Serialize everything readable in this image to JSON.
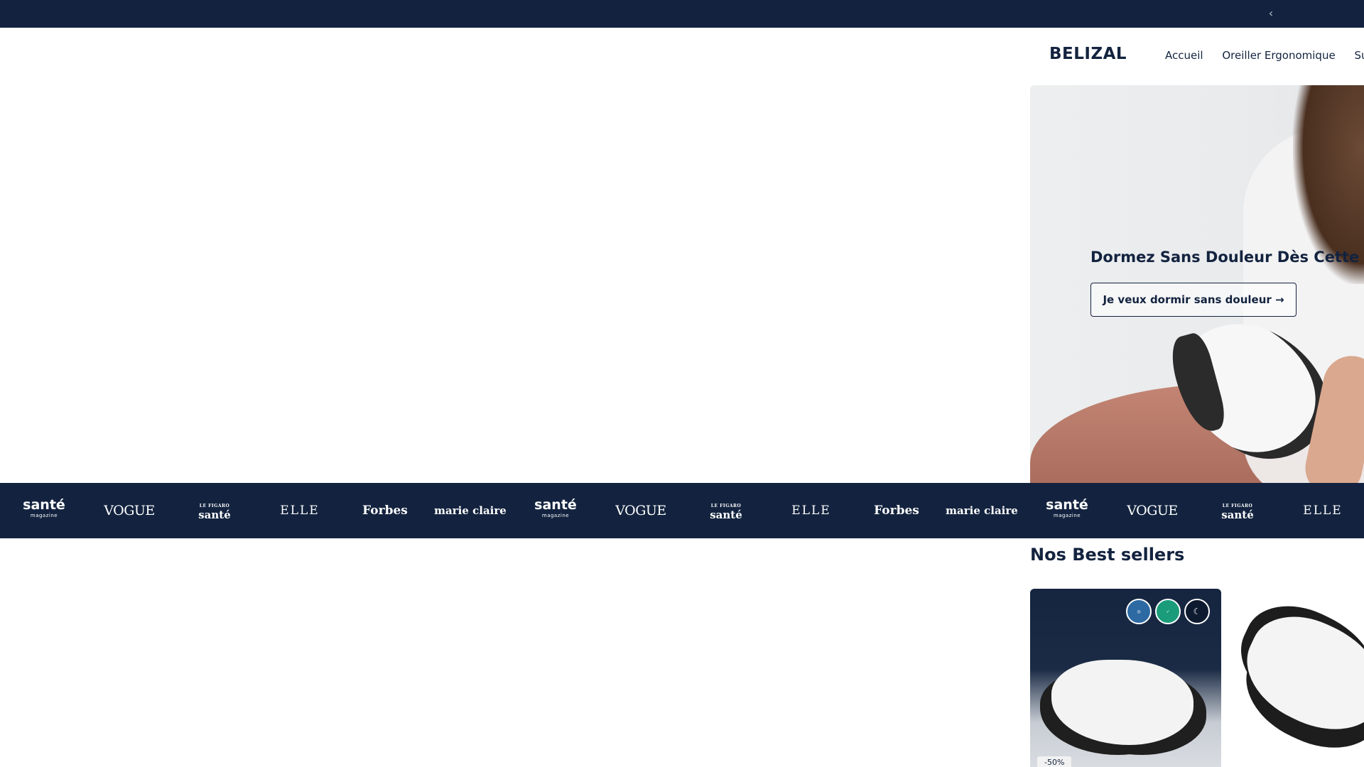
{
  "topbar": {
    "prev_glyph": "‹"
  },
  "header": {
    "logo": "BELIZAL",
    "nav": [
      "Accueil",
      "Oreiller Ergonomique",
      "Suivi"
    ]
  },
  "hero": {
    "title": "Dormez Sans Douleur Dès Cette Nuit",
    "cta": "Je veux dormir sans douleur →"
  },
  "press": {
    "logos": [
      {
        "name": "santé",
        "sub": "magazine",
        "style": "sante"
      },
      {
        "name": "VOGUE",
        "style": "vogue"
      },
      {
        "name": "santé",
        "sub": "LE FIGARO",
        "style": "figaro"
      },
      {
        "name": "ELLE",
        "style": "elle"
      },
      {
        "name": "Forbes",
        "style": "forbes"
      },
      {
        "name": "marie claire",
        "style": "marie"
      },
      {
        "name": "santé",
        "sub": "magazine",
        "style": "sante"
      },
      {
        "name": "VOGUE",
        "style": "vogue"
      },
      {
        "name": "santé",
        "sub": "LE FIGARO",
        "style": "figaro"
      },
      {
        "name": "ELLE",
        "style": "elle"
      },
      {
        "name": "Forbes",
        "style": "forbes"
      },
      {
        "name": "marie claire",
        "style": "marie"
      },
      {
        "name": "santé",
        "sub": "magazine",
        "style": "sante"
      },
      {
        "name": "VOGUE",
        "style": "vogue"
      },
      {
        "name": "santé",
        "sub": "LE FIGARO",
        "style": "figaro"
      },
      {
        "name": "ELLE",
        "style": "elle"
      }
    ]
  },
  "bestsellers": {
    "title": "Nos Best sellers",
    "card1": {
      "sale_badge": "-50%",
      "cert_badges": [
        "oeko-icon",
        "oeko-tex-icon",
        "moon-icon"
      ]
    }
  },
  "colors": {
    "navy": "#13233f",
    "white": "#ffffff"
  }
}
